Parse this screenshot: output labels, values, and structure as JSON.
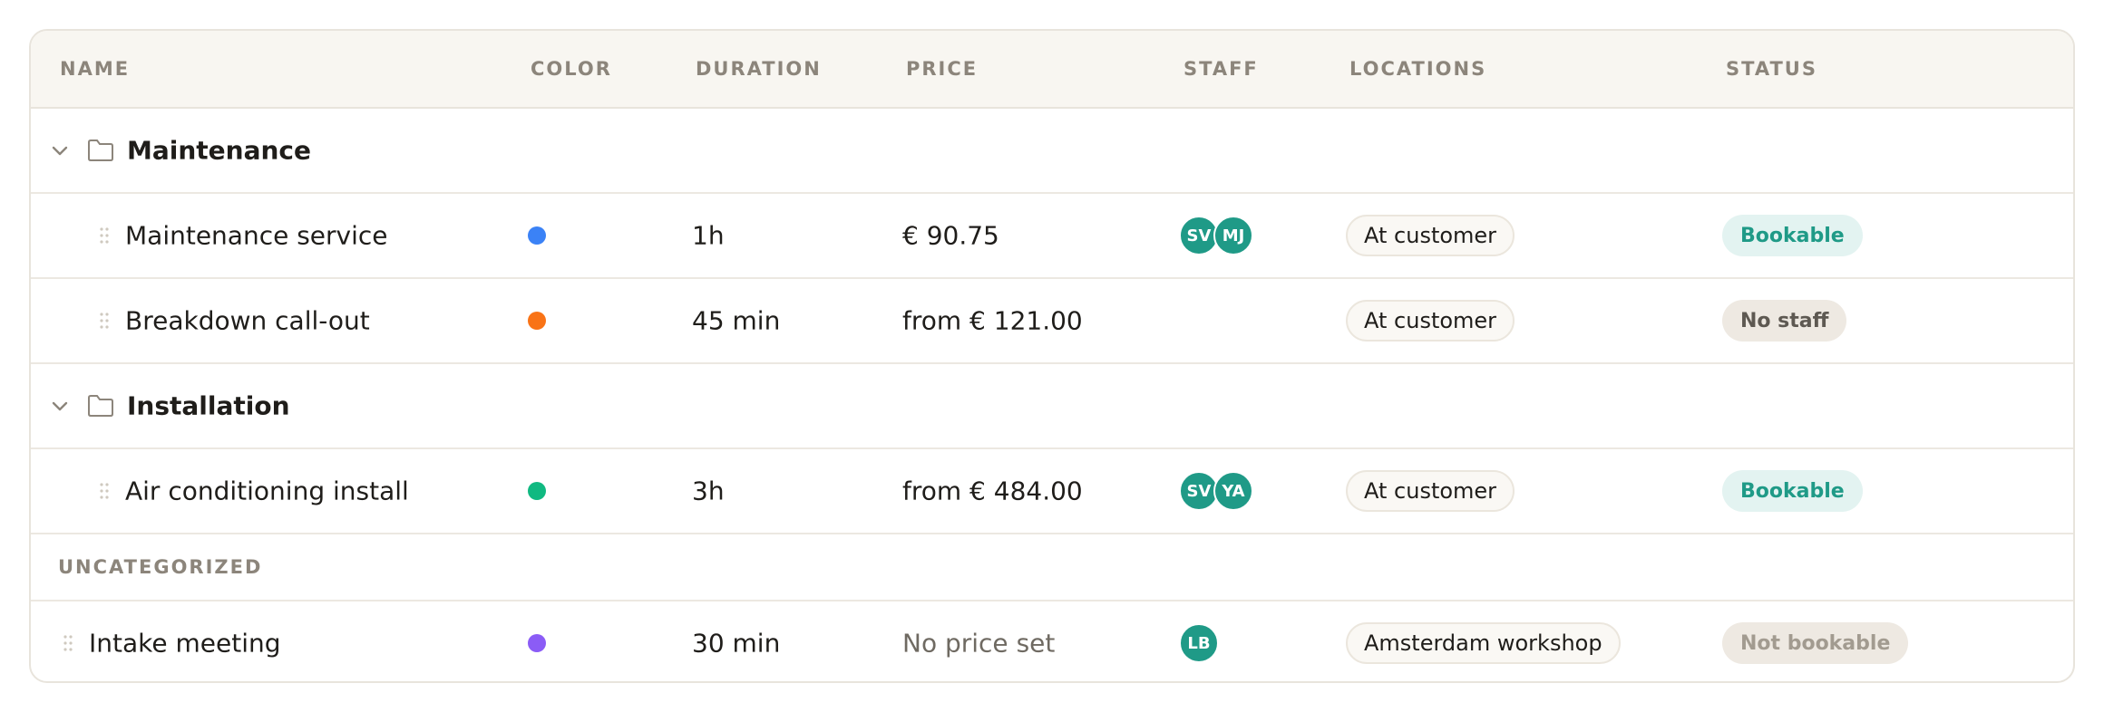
{
  "columns": {
    "name": "NAME",
    "color": "COLOR",
    "duration": "DURATION",
    "price": "PRICE",
    "staff": "STAFF",
    "locations": "LOCATIONS",
    "status": "STATUS"
  },
  "groups": [
    {
      "title": "Maintenance",
      "services": [
        {
          "name": "Maintenance service",
          "color": "#3b82f6",
          "duration": "1h",
          "price": "€ 90.75",
          "staff": [
            "SV",
            "MJ"
          ],
          "location": "At customer",
          "status": "Bookable"
        },
        {
          "name": "Breakdown call-out",
          "color": "#f97316",
          "duration": "45 min",
          "price": "from € 121.00",
          "staff": [],
          "location": "At customer",
          "status": "No staff"
        }
      ]
    },
    {
      "title": "Installation",
      "services": [
        {
          "name": "Air conditioning install",
          "color": "#10b981",
          "duration": "3h",
          "price": "from € 484.00",
          "staff": [
            "SV",
            "YA"
          ],
          "location": "At customer",
          "status": "Bookable"
        }
      ]
    }
  ],
  "uncategorized": {
    "label": "UNCATEGORIZED",
    "services": [
      {
        "name": "Intake meeting",
        "color": "#8b5cf6",
        "duration": "30 min",
        "price": "No price set",
        "staff": [
          "LB"
        ],
        "location": "Amsterdam workshop",
        "status": "Not bookable"
      }
    ]
  },
  "icons": {
    "chevron": "chevron-down-icon",
    "folder": "folder-icon",
    "drag": "drag-handle-icon"
  }
}
